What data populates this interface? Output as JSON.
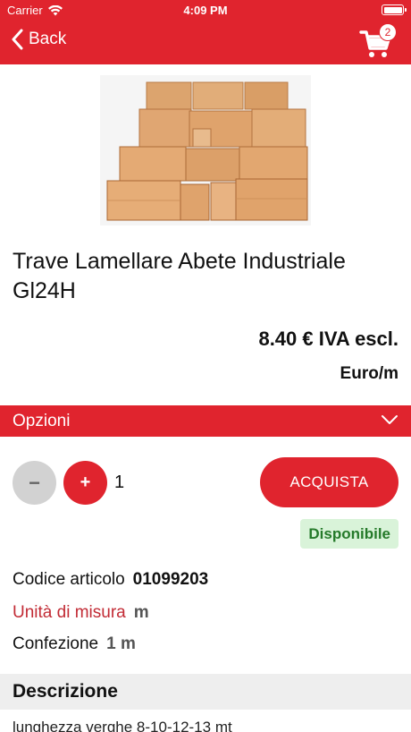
{
  "status_bar": {
    "carrier": "Carrier",
    "time": "4:09 PM"
  },
  "nav": {
    "back_label": "Back",
    "cart_count": "2",
    "header_color": "#e0242e"
  },
  "product": {
    "title": "Trave Lamellare Abete Industriale Gl24H",
    "price": "8.40 € IVA escl.",
    "unit": "Euro/m"
  },
  "options": {
    "label": "Opzioni"
  },
  "purchase": {
    "minus_label": "−",
    "plus_label": "+",
    "quantity": "1",
    "buy_label": "ACQUISTA",
    "availability": "Disponibile"
  },
  "specs": {
    "code_label": "Codice articolo",
    "code_value": "01099203",
    "measure_label": "Unità di misura",
    "measure_value": "m",
    "package_label": "Confezione",
    "package_value": "1 m"
  },
  "description": {
    "title": "Descrizione",
    "text": "lunghezza verghe 8-10-12-13 mt"
  },
  "icons": {
    "back": "chevron-left-icon",
    "cart": "shopping-cart-icon",
    "options": "chevron-down-icon",
    "wifi": "wifi-icon",
    "battery": "battery-icon"
  }
}
